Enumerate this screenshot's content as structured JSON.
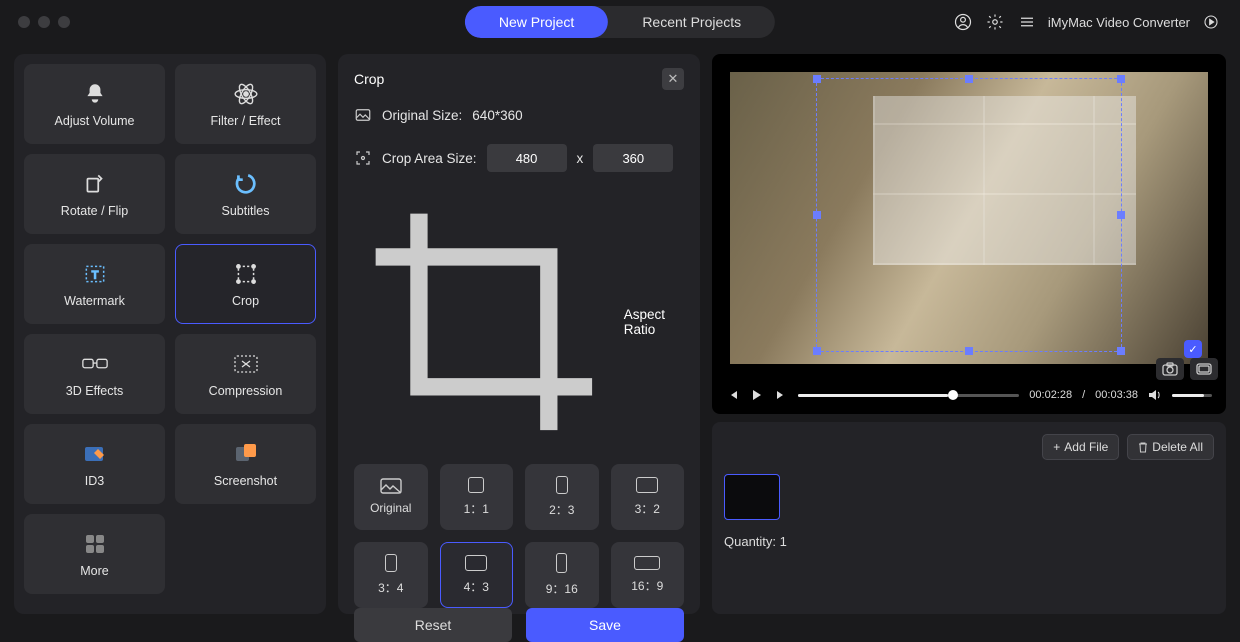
{
  "header": {
    "tabs": {
      "new": "New Project",
      "recent": "Recent Projects"
    },
    "app_name": "iMyMac Video Converter"
  },
  "sidebar": {
    "tools": [
      {
        "label": "Adjust Volume"
      },
      {
        "label": "Filter / Effect"
      },
      {
        "label": "Rotate / Flip"
      },
      {
        "label": "Subtitles"
      },
      {
        "label": "Watermark"
      },
      {
        "label": "Crop"
      },
      {
        "label": "3D Effects"
      },
      {
        "label": "Compression"
      },
      {
        "label": "ID3"
      },
      {
        "label": "Screenshot"
      },
      {
        "label": "More"
      }
    ]
  },
  "crop": {
    "title": "Crop",
    "original_label": "Original Size:",
    "original_value": "640*360",
    "area_label": "Crop Area Size:",
    "width": "480",
    "height": "360",
    "x_sep": "x",
    "aspect_label": "Aspect Ratio",
    "ratios": [
      "Original",
      "1：1",
      "2：3",
      "3：2",
      "3：4",
      "4：3",
      "9：16",
      "16：9"
    ],
    "reset": "Reset",
    "save": "Save",
    "selected_ratio": "4：3"
  },
  "player": {
    "current": "00:02:28",
    "total": "00:03:38",
    "sep": " / "
  },
  "shelf": {
    "add": "Add File",
    "delete": "Delete All",
    "quantity_label": "Quantity:",
    "quantity": "1"
  }
}
